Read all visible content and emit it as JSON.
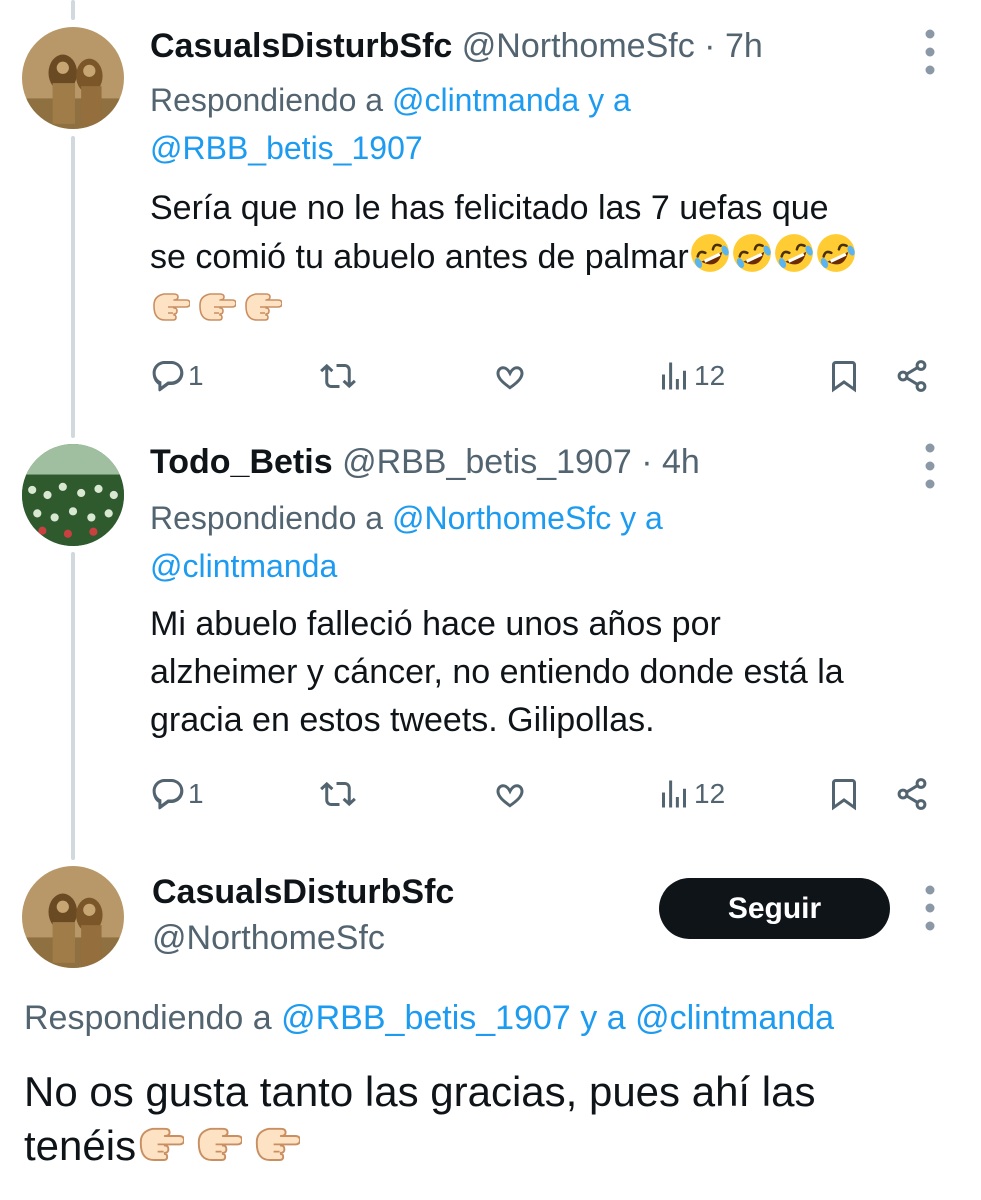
{
  "tweet1": {
    "name": "CasualsDisturbSfc",
    "handle": "@NorthomeSfc",
    "separator": "·",
    "time": "7h",
    "reply_prefix": "Respondiendo a",
    "reply_mention_1": "@clintmanda",
    "reply_conj": "y a",
    "reply_mention_2": "@RBB_betis_1907",
    "text_line1": "Sería que no le has felicitado las 7 uefas que",
    "text_line2": "se comió tu abuelo antes de palmar",
    "emojis_line2": [
      "rolling-on-floor-laughing",
      "rolling-on-floor-laughing",
      "rolling-on-floor-laughing",
      "rolling-on-floor-laughing"
    ],
    "emojis_line3": [
      "backhand-index-pointing-right",
      "backhand-index-pointing-right",
      "backhand-index-pointing-right"
    ],
    "reply_count": "1",
    "views_count": "12"
  },
  "tweet2": {
    "name": "Todo_Betis",
    "handle": "@RBB_betis_1907",
    "separator": "·",
    "time": "4h",
    "reply_prefix": "Respondiendo a",
    "reply_mention_1": "@NorthomeSfc",
    "reply_conj": "y a",
    "reply_mention_2": "@clintmanda",
    "text_line1": "Mi abuelo falleció hace unos años por",
    "text_line2": "alzheimer y cáncer, no entiendo donde está la",
    "text_line3": "gracia en estos tweets. Gilipollas.",
    "reply_count": "1",
    "views_count": "12"
  },
  "main_tweet": {
    "name": "CasualsDisturbSfc",
    "handle": "@NorthomeSfc",
    "follow_label": "Seguir",
    "reply_prefix": "Respondiendo a",
    "reply_mention_1": "@RBB_betis_1907",
    "reply_conj": "y a",
    "reply_mention_2": "@clintmanda",
    "text_line1": "No os gusta tanto las gracias, pues ahí las",
    "text_line2": "tenéis",
    "emojis": [
      "backhand-index-pointing-right",
      "backhand-index-pointing-right",
      "backhand-index-pointing-right"
    ]
  },
  "colors": {
    "link": "#1d9bf0",
    "secondary_text": "#536471",
    "primary_text": "#0f1419",
    "thread_line": "#cfd9de",
    "follow_button_bg": "#0f1419"
  },
  "icons": {
    "reply": "speech-bubble-icon",
    "retweet": "retweet-icon",
    "like": "heart-icon",
    "views": "bar-chart-icon",
    "bookmark": "bookmark-icon",
    "share": "share-icon",
    "more": "more-vertical-icon"
  }
}
